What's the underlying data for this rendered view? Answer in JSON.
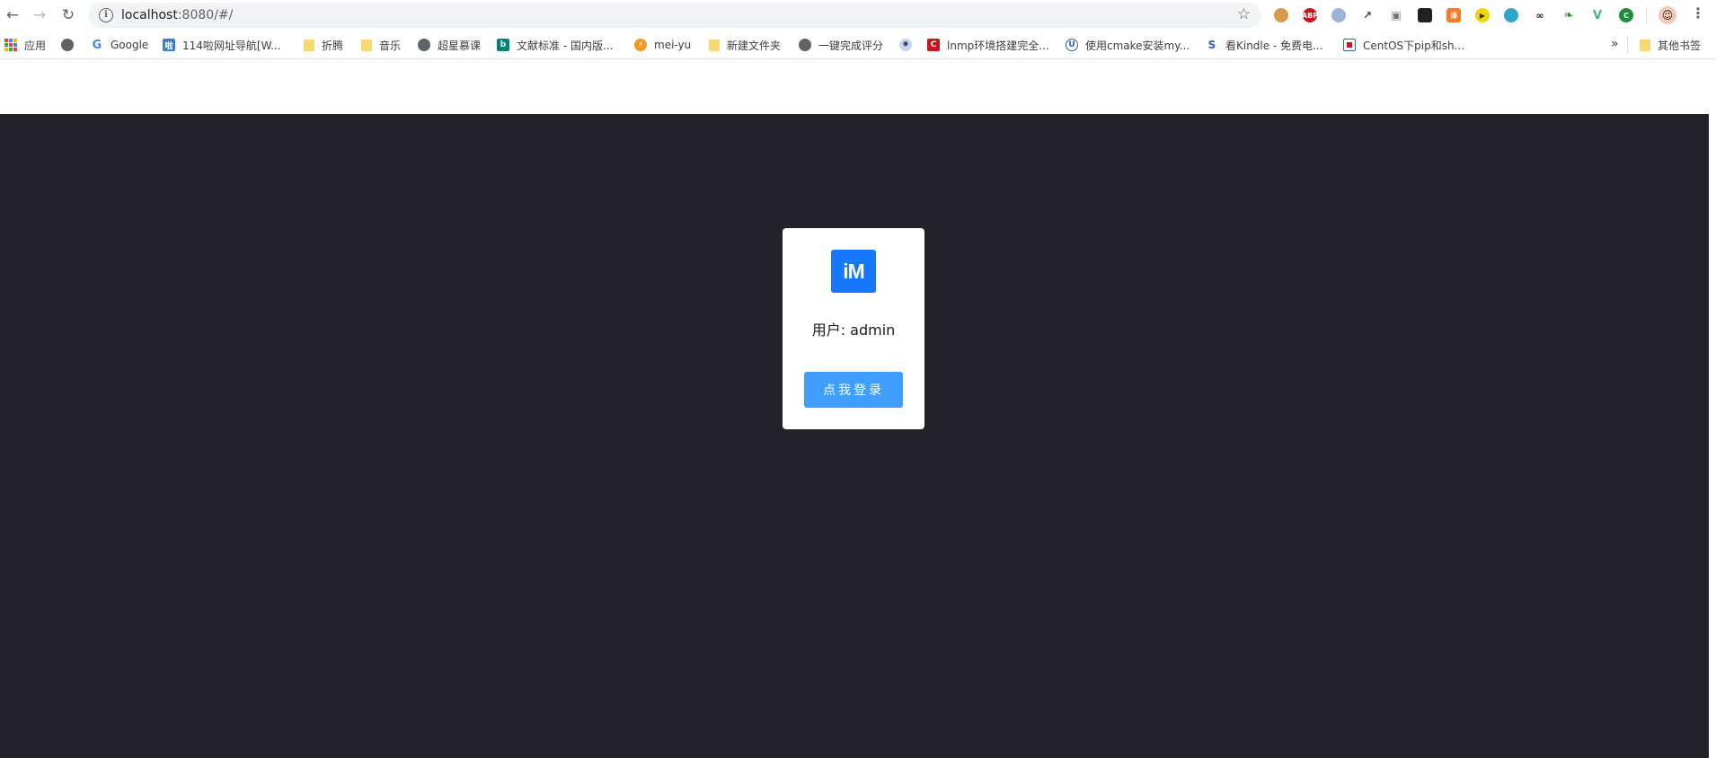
{
  "browser": {
    "url_host": "localhost",
    "url_rest": ":8080/#/"
  },
  "bookmarks": [
    {
      "label": "应用",
      "icon": "apps-grid-icon"
    },
    {
      "label": "",
      "icon": "globe-icon"
    },
    {
      "label": "Google",
      "icon": "google-icon"
    },
    {
      "label": "114啦网址导航[W...",
      "icon": "site-icon"
    },
    {
      "label": "折腾",
      "icon": "folder-icon"
    },
    {
      "label": "音乐",
      "icon": "folder-icon"
    },
    {
      "label": "超星慕课",
      "icon": "globe-icon"
    },
    {
      "label": "文献标准 - 国内版...",
      "icon": "bing-icon"
    },
    {
      "label": "mei-yu",
      "icon": "bolt-icon"
    },
    {
      "label": "新建文件夹",
      "icon": "folder-icon"
    },
    {
      "label": "一键完成评分",
      "icon": "globe-icon"
    },
    {
      "label": "",
      "icon": "gear-site-icon"
    },
    {
      "label": "lnmp环境搭建完全...",
      "icon": "csdn-icon"
    },
    {
      "label": "使用cmake安装my...",
      "icon": "u-site-icon"
    },
    {
      "label": "看Kindle - 免费电...",
      "icon": "s-site-icon"
    },
    {
      "label": "CentOS下pip和sh...",
      "icon": "centos-site-icon"
    }
  ],
  "bookmarks_overflow": "»",
  "other_bookmarks": "其他书签",
  "login": {
    "logo_text": "iM",
    "user_line": "用户: admin",
    "button_label": "点我登录"
  },
  "colors": {
    "page_background": "#222228",
    "logo": "#1677ff",
    "button": "#409eff"
  }
}
